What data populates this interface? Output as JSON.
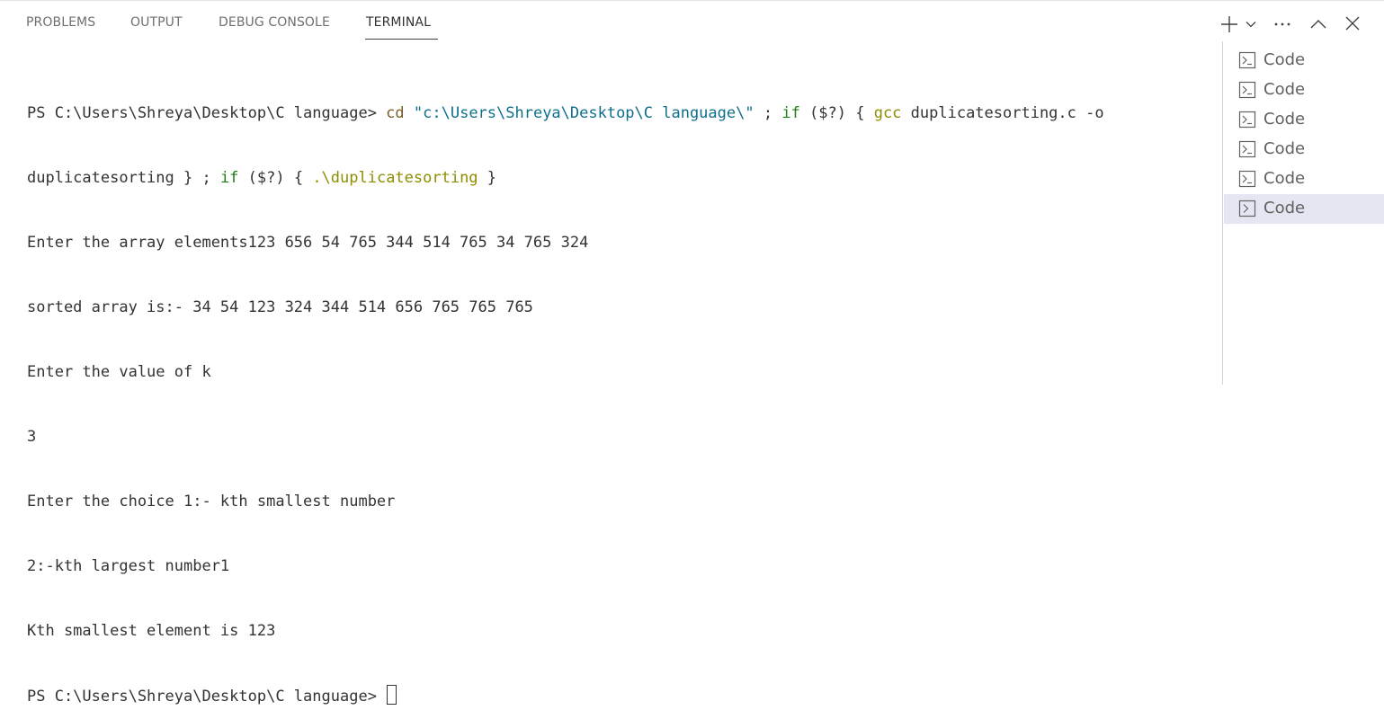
{
  "panel": {
    "tabs": [
      {
        "label": "PROBLEMS"
      },
      {
        "label": "OUTPUT"
      },
      {
        "label": "DEBUG CONSOLE"
      },
      {
        "label": "TERMINAL"
      }
    ],
    "active_tab": "TERMINAL"
  },
  "toolbar": {
    "icons": [
      "plus-icon",
      "chevron-down-icon",
      "more-icon",
      "chevron-up-icon",
      "close-icon"
    ]
  },
  "terminal": {
    "line1": {
      "prompt": "PS C:\\Users\\Shreya\\Desktop\\C language> ",
      "cmd": "cd",
      "sp1": " ",
      "path": "\"c:\\Users\\Shreya\\Desktop\\C language\\\"",
      "sep": " ; ",
      "if1": "if",
      "cond1": " ($?) { ",
      "gcc": "gcc",
      "rest": " duplicatesorting.c -o"
    },
    "line2": {
      "a": "duplicatesorting } ; ",
      "if2": "if",
      "cond2": " ($?) { ",
      "exe": ".\\duplicatesorting",
      "end": " }"
    },
    "output": [
      "Enter the array elements123 656 54 765 344 514 765 34 765 324",
      "sorted array is:- 34 54 123 324 344 514 656 765 765 765",
      "Enter the value of k",
      "3",
      "Enter the choice 1:- kth smallest number",
      "2:-kth largest number1",
      "Kth smallest element is 123"
    ],
    "final_prompt": "PS C:\\Users\\Shreya\\Desktop\\C language> "
  },
  "terminal_list": {
    "items": [
      {
        "label": "Code"
      },
      {
        "label": "Code"
      },
      {
        "label": "Code"
      },
      {
        "label": "Code"
      },
      {
        "label": "Code"
      },
      {
        "label": "Code"
      }
    ],
    "selected_index": 5
  },
  "colors": {
    "command": "#795e26",
    "string": "#0e6f8d",
    "keyword": "#1a7f11",
    "exe": "#8e8e00",
    "selection": "#e4e6f1"
  }
}
